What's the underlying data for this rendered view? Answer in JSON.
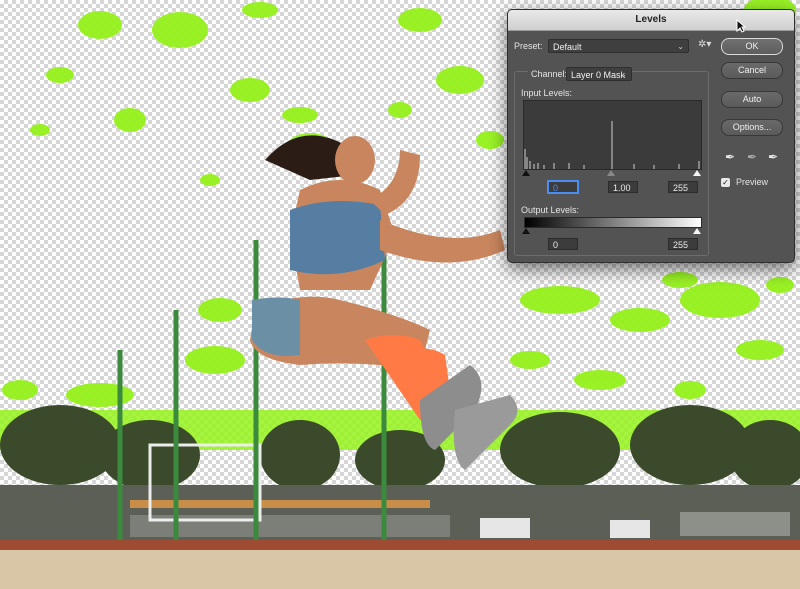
{
  "dialog": {
    "title": "Levels",
    "preset_label": "Preset:",
    "preset_value": "Default",
    "channel_label": "Channel:",
    "channel_value": "Layer 0 Mask",
    "input_levels_label": "Input Levels:",
    "input_black": "0",
    "input_gamma": "1.00",
    "input_white": "255",
    "output_levels_label": "Output Levels:",
    "output_black": "0",
    "output_white": "255",
    "buttons": {
      "ok": "OK",
      "cancel": "Cancel",
      "auto": "Auto",
      "options": "Options..."
    },
    "preview_label": "Preview",
    "preview_checked": true,
    "eyedroppers": [
      "black-point-eyedropper-icon",
      "gray-point-eyedropper-icon",
      "white-point-eyedropper-icon"
    ]
  },
  "colors": {
    "mask_overlay": "#95f21b",
    "dialog_bg": "#535353",
    "focus_ring": "#4c8ef0"
  }
}
